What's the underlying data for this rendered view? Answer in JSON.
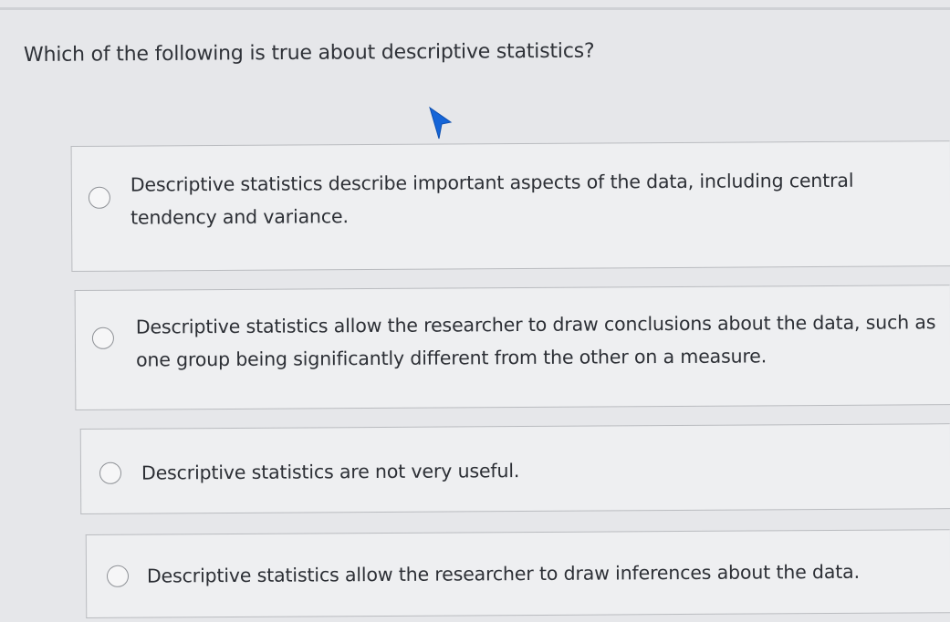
{
  "question": {
    "text": "Which of the following is true about descriptive statistics?"
  },
  "choices": [
    {
      "label": "Descriptive statistics describe important aspects of the data, including central tendency and variance."
    },
    {
      "label": "Descriptive statistics allow the researcher to draw conclusions about the data, such as one group being significantly different from the other on a measure."
    },
    {
      "label": "Descriptive statistics are not very useful."
    },
    {
      "label": "Descriptive statistics allow the researcher to draw inferences about the data."
    }
  ],
  "icons": {
    "radio": "radio-unselected-icon",
    "cursor": "mouse-pointer-icon"
  },
  "colors": {
    "background": "#e6e7ea",
    "choice_background": "#eeeff1",
    "border": "#b9bbbf",
    "text": "#2c2f35"
  }
}
